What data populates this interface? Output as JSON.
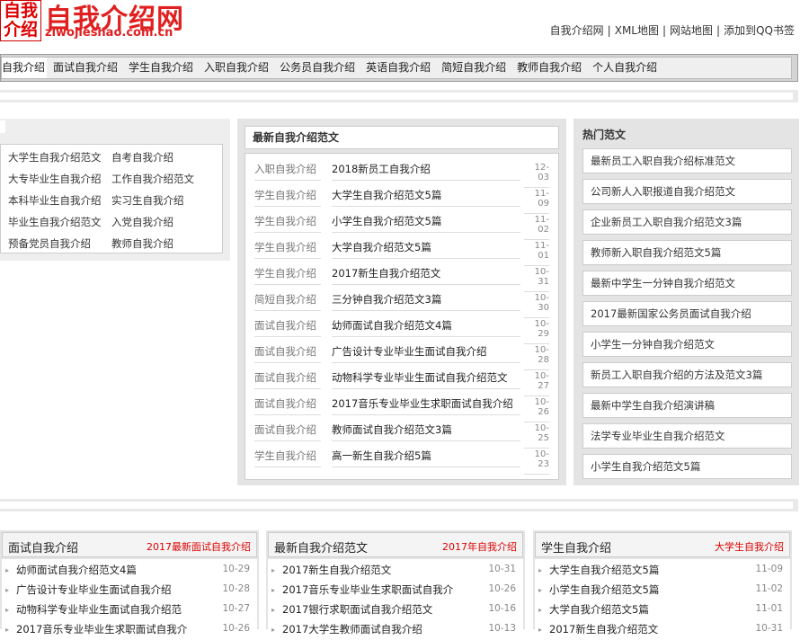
{
  "logo": {
    "box_line1": "自我",
    "box_line2": "介绍",
    "title": "自我介绍网",
    "domain": "ziwojieshao.com.cn"
  },
  "top_links": [
    "自我介绍网",
    "XML地图",
    "网站地图",
    "添加到QQ书签"
  ],
  "nav": [
    "自我介绍",
    "面试自我介绍",
    "学生自我介绍",
    "入职自我介绍",
    "公务员自我介绍",
    "英语自我介绍",
    "简短自我介绍",
    "教师自我介绍",
    "个人自我介绍"
  ],
  "left_links": [
    [
      "大学生自我介绍范文",
      "自考自我介绍"
    ],
    [
      "大专毕业生自我介绍",
      "工作自我介绍范文"
    ],
    [
      "本科毕业生自我介绍",
      "实习生自我介绍"
    ],
    [
      "毕业生自我介绍范文",
      "入党自我介绍"
    ],
    [
      "预备党员自我介绍",
      "教师自我介绍"
    ]
  ],
  "latest": {
    "title": "最新自我介绍范文",
    "rows": [
      {
        "cat": "入职自我介绍",
        "title": "2018新员工自我介绍",
        "date": "12-03"
      },
      {
        "cat": "学生自我介绍",
        "title": "大学生自我介绍范文5篇",
        "date": "11-09"
      },
      {
        "cat": "学生自我介绍",
        "title": "小学生自我介绍范文5篇",
        "date": "11-02"
      },
      {
        "cat": "学生自我介绍",
        "title": "大学自我介绍范文5篇",
        "date": "11-01"
      },
      {
        "cat": "学生自我介绍",
        "title": "2017新生自我介绍范文",
        "date": "10-31"
      },
      {
        "cat": "简短自我介绍",
        "title": "三分钟自我介绍范文3篇",
        "date": "10-30"
      },
      {
        "cat": "面试自我介绍",
        "title": "幼师面试自我介绍范文4篇",
        "date": "10-29"
      },
      {
        "cat": "面试自我介绍",
        "title": "广告设计专业毕业生面试自我介绍",
        "date": "10-28"
      },
      {
        "cat": "面试自我介绍",
        "title": "动物科学专业毕业生面试自我介绍范文",
        "date": "10-27"
      },
      {
        "cat": "面试自我介绍",
        "title": "2017音乐专业毕业生求职面试自我介绍",
        "date": "10-26"
      },
      {
        "cat": "面试自我介绍",
        "title": "教师面试自我介绍范文3篇",
        "date": "10-25"
      },
      {
        "cat": "学生自我介绍",
        "title": "高一新生自我介绍5篇",
        "date": "10-23"
      }
    ]
  },
  "hot": {
    "title": "热门范文",
    "items": [
      "最新员工入职自我介绍标准范文",
      "公司新人入职报道自我介绍范文",
      "企业新员工入职自我介绍范文3篇",
      "教师新入职自我介绍范文5篇",
      "最新中学生一分钟自我介绍范文",
      "2017最新国家公务员面试自我介绍",
      "小学生一分钟自我介绍范文",
      "新员工入职自我介绍的方法及范文3篇",
      "最新中学生自我介绍演讲稿",
      "法学专业毕业生自我介绍范文",
      "小学生自我介绍范文5篇"
    ]
  },
  "columns": [
    {
      "title": "面试自我介绍",
      "more": "2017最新面试自我介绍",
      "rows": [
        {
          "t": "幼师面试自我介绍范文4篇",
          "d": "10-29"
        },
        {
          "t": "广告设计专业毕业生面试自我介绍",
          "d": "10-28"
        },
        {
          "t": "动物科学专业毕业生面试自我介绍范",
          "d": "10-27"
        },
        {
          "t": "2017音乐专业毕业生求职面试自我介",
          "d": "10-26"
        }
      ]
    },
    {
      "title": "最新自我介绍范文",
      "more": "2017年自我介绍",
      "rows": [
        {
          "t": "2017新生自我介绍范文",
          "d": "10-31"
        },
        {
          "t": "2017音乐专业毕业生求职面试自我介",
          "d": "10-26"
        },
        {
          "t": "2017银行求职面试自我介绍范文",
          "d": "10-16"
        },
        {
          "t": "2017大学生教师面试自我介绍",
          "d": "10-13"
        }
      ]
    },
    {
      "title": "学生自我介绍",
      "more": "大学生自我介绍",
      "rows": [
        {
          "t": "大学生自我介绍范文5篇",
          "d": "11-09"
        },
        {
          "t": "小学生自我介绍范文5篇",
          "d": "11-02"
        },
        {
          "t": "大学自我介绍范文5篇",
          "d": "11-01"
        },
        {
          "t": "2017新生自我介绍范文",
          "d": "10-31"
        }
      ]
    }
  ]
}
